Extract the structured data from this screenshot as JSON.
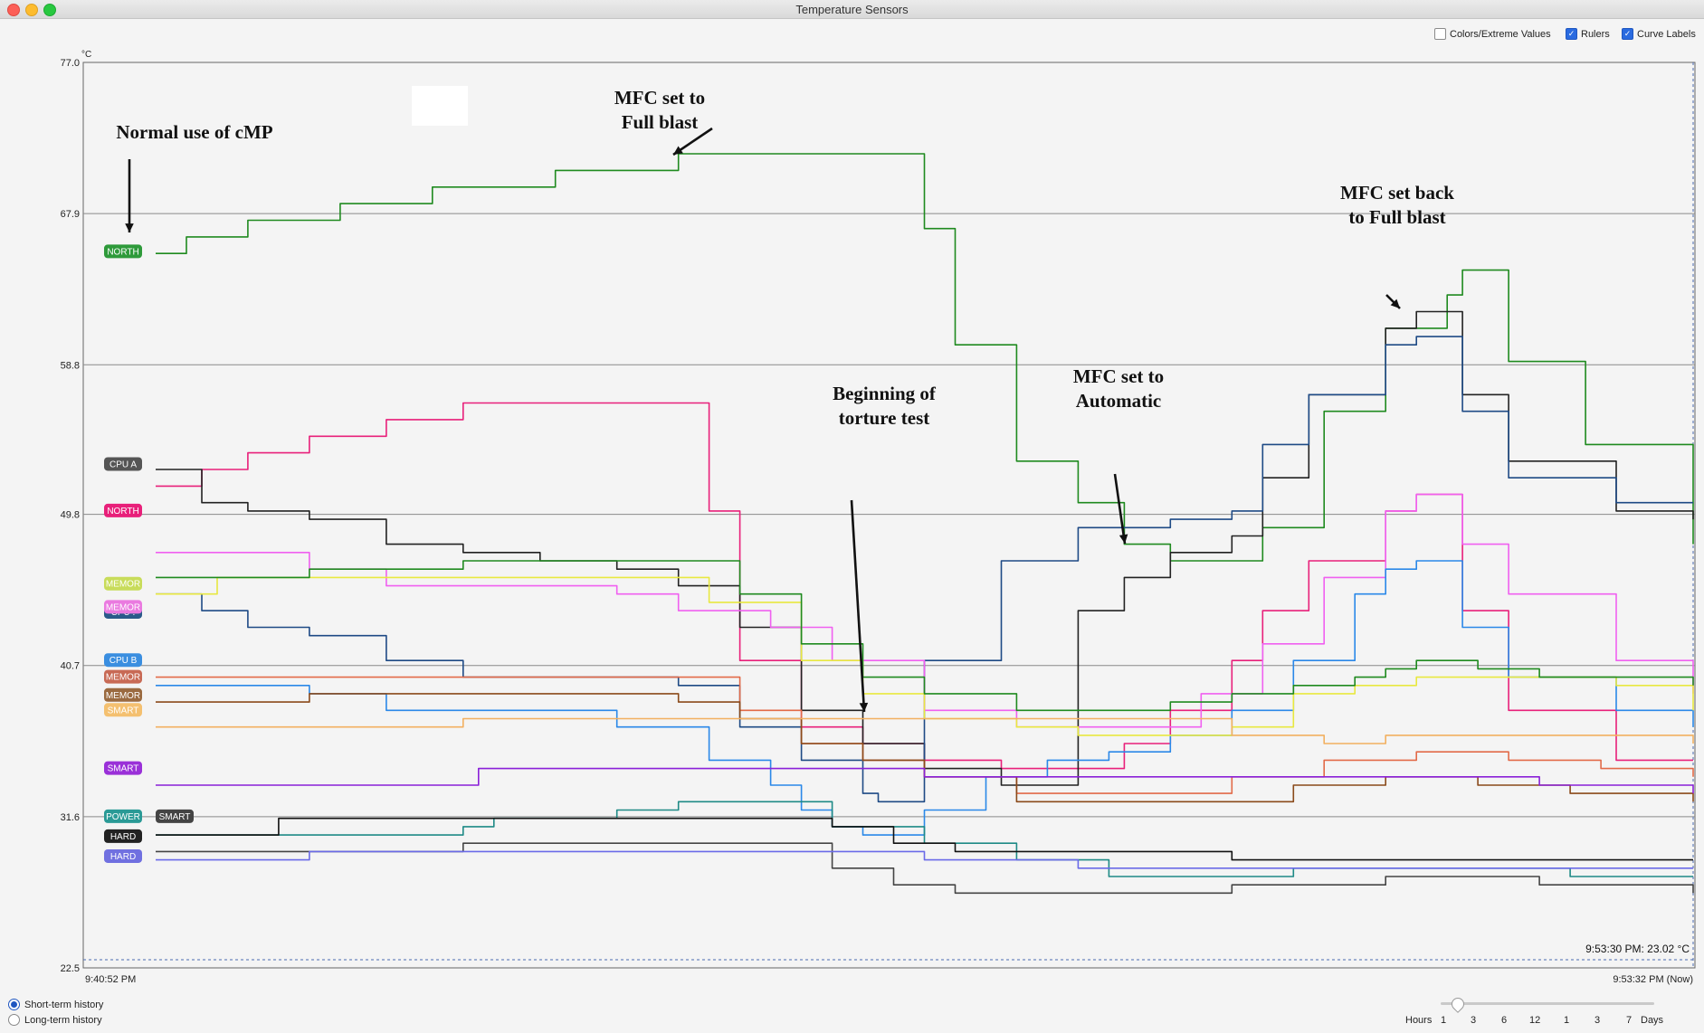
{
  "window": {
    "title": "Temperature Sensors"
  },
  "options": [
    {
      "label": "Colors/Extreme Values",
      "checked": false
    },
    {
      "label": "Rulers",
      "checked": true
    },
    {
      "label": "Curve Labels",
      "checked": true
    }
  ],
  "history": {
    "short_label": "Short-term history",
    "long_label": "Long-term history",
    "selected": "short"
  },
  "timescale": {
    "hours_label": "Hours",
    "days_label": "Days",
    "ticks": [
      "1",
      "3",
      "6",
      "12",
      "1",
      "3",
      "7"
    ]
  },
  "chart_data": {
    "type": "line",
    "unit": "°C",
    "ylim": [
      22.5,
      77.0
    ],
    "yticks": [
      "77.0",
      "67.9",
      "58.8",
      "49.8",
      "40.7",
      "31.6",
      "22.5"
    ],
    "x_start": "9:40:52 PM",
    "x_end": "9:53:32 PM (Now)",
    "readout": "9:53:30 PM: 23.02 °C",
    "grid": true,
    "curve_labels": [
      {
        "text": "NORTH",
        "color": "#2e9a3a"
      },
      {
        "text": "CPU A",
        "color": "#555555"
      },
      {
        "text": "NORTH",
        "color": "#e8207a"
      },
      {
        "text": "MEMOR",
        "color": "#c8dc5a"
      },
      {
        "text": "CPU .",
        "color": "#2a5a8a"
      },
      {
        "text": "MEMOR",
        "color": "#ea7ae0"
      },
      {
        "text": "CPU B",
        "color": "#3a8ee0"
      },
      {
        "text": "MEMOR",
        "color": "#c86a55"
      },
      {
        "text": "MEMOR",
        "color": "#9a6a40"
      },
      {
        "text": "SMART",
        "color": "#f4c070"
      },
      {
        "text": "SMART",
        "color": "#9a30d8"
      },
      {
        "text": "POWER",
        "color": "#2a9a96"
      },
      {
        "text": "SMART",
        "color": "#444444"
      },
      {
        "text": "HARD",
        "color": "#222222"
      },
      {
        "text": "HARD",
        "color": "#7070e0"
      }
    ],
    "annotations": [
      {
        "lines": [
          "Normal use of cMP"
        ]
      },
      {
        "lines": [
          "MFC set to",
          "Full blast"
        ]
      },
      {
        "lines": [
          "Beginning of",
          "torture test"
        ]
      },
      {
        "lines": [
          "MFC set to",
          "Automatic"
        ]
      },
      {
        "lines": [
          "MFC  set back",
          "to Full blast"
        ]
      }
    ],
    "series": [
      {
        "color": "#1f8a1f",
        "t": [
          0,
          0.02,
          0.06,
          0.12,
          0.18,
          0.26,
          0.34,
          0.4,
          0.44,
          0.46,
          0.5,
          0.52,
          0.56,
          0.6,
          0.63,
          0.66,
          0.69,
          0.72,
          0.76,
          0.8,
          0.84,
          0.85,
          0.88,
          0.93,
          1
        ],
        "y": [
          65.5,
          66.5,
          67.5,
          68.5,
          69.5,
          70.5,
          71.5,
          71.5,
          71.5,
          71.5,
          67,
          60,
          53,
          50.5,
          48,
          47,
          47,
          49,
          56,
          61,
          63,
          64.5,
          59,
          54,
          48
        ]
      },
      {
        "color": "#e8207a",
        "t": [
          0,
          0.03,
          0.06,
          0.1,
          0.15,
          0.2,
          0.3,
          0.34,
          0.36,
          0.38,
          0.42,
          0.46,
          0.5,
          0.55,
          0.6,
          0.63,
          0.66,
          0.7,
          0.72,
          0.75,
          0.8,
          0.82,
          0.85,
          0.88,
          0.95,
          1
        ],
        "y": [
          51.5,
          52.5,
          53.5,
          54.5,
          55.5,
          56.5,
          56.5,
          56.5,
          50,
          41,
          37,
          36,
          35,
          34.5,
          34.5,
          36,
          38,
          41,
          44,
          47,
          50,
          51,
          44,
          38,
          35,
          35
        ]
      },
      {
        "color": "#222222",
        "t": [
          0,
          0.03,
          0.06,
          0.1,
          0.15,
          0.2,
          0.25,
          0.3,
          0.34,
          0.38,
          0.42,
          0.46,
          0.5,
          0.55,
          0.6,
          0.63,
          0.66,
          0.7,
          0.72,
          0.75,
          0.8,
          0.82,
          0.85,
          0.88,
          0.95,
          1
        ],
        "y": [
          52.5,
          50.5,
          50,
          49.5,
          48,
          47.5,
          47,
          46.5,
          45.5,
          43,
          38,
          36,
          34.5,
          33.5,
          44,
          46,
          47.5,
          48.5,
          52,
          57,
          61,
          62,
          57,
          53,
          50,
          49.5
        ]
      },
      {
        "color": "#1e4a85",
        "t": [
          0,
          0.03,
          0.06,
          0.1,
          0.15,
          0.2,
          0.25,
          0.3,
          0.34,
          0.38,
          0.42,
          0.46,
          0.47,
          0.5,
          0.55,
          0.6,
          0.63,
          0.66,
          0.7,
          0.72,
          0.75,
          0.8,
          0.82,
          0.85,
          0.88,
          0.95,
          1
        ],
        "y": [
          45,
          44,
          43,
          42.5,
          41,
          40,
          40,
          40,
          39.5,
          37,
          35,
          33,
          32.5,
          41,
          47,
          49,
          49,
          49.5,
          50,
          54,
          57,
          60,
          60.5,
          56,
          52,
          50.5,
          50.5
        ]
      },
      {
        "color": "#f060f0",
        "t": [
          0,
          0.06,
          0.1,
          0.15,
          0.3,
          0.34,
          0.4,
          0.44,
          0.5,
          0.56,
          0.6,
          0.64,
          0.68,
          0.72,
          0.76,
          0.8,
          0.82,
          0.85,
          0.88,
          0.95,
          1
        ],
        "y": [
          47.5,
          47.5,
          46.5,
          45.5,
          45,
          44,
          43,
          41,
          38,
          37,
          37,
          37,
          39,
          42,
          46,
          50,
          51,
          48,
          45,
          41,
          39
        ]
      },
      {
        "color": "#2a88e8",
        "t": [
          0,
          0.06,
          0.1,
          0.15,
          0.3,
          0.36,
          0.4,
          0.42,
          0.44,
          0.46,
          0.5,
          0.54,
          0.58,
          0.62,
          0.66,
          0.7,
          0.74,
          0.78,
          0.8,
          0.82,
          0.85,
          0.88,
          0.95,
          1
        ],
        "y": [
          39.5,
          39.5,
          39,
          38,
          37,
          35,
          33.5,
          32,
          31,
          30.5,
          32,
          34,
          35,
          35.5,
          36.5,
          38,
          41,
          45,
          46.5,
          47,
          43,
          40,
          38,
          37
        ]
      },
      {
        "color": "#e8e840",
        "t": [
          0,
          0.04,
          0.08,
          0.15,
          0.3,
          0.36,
          0.42,
          0.46,
          0.5,
          0.56,
          0.6,
          0.64,
          0.7,
          0.74,
          0.78,
          0.82,
          0.86,
          0.9,
          0.95,
          1
        ],
        "y": [
          45,
          46,
          46,
          46,
          46,
          44.5,
          41,
          39,
          37.5,
          37,
          36.5,
          36.5,
          37,
          39,
          39.5,
          40,
          40,
          40,
          39.5,
          38
        ]
      },
      {
        "color": "#1f8a1f",
        "t": [
          0,
          0.05,
          0.1,
          0.2,
          0.3,
          0.34,
          0.38,
          0.42,
          0.46,
          0.5,
          0.56,
          0.62,
          0.66,
          0.7,
          0.74,
          0.78,
          0.8,
          0.82,
          0.86,
          0.9,
          1
        ],
        "y": [
          46,
          46,
          46.5,
          47,
          47,
          47,
          45,
          42,
          40,
          39,
          38,
          38,
          38.5,
          39,
          39.5,
          40,
          40.5,
          41,
          40.5,
          40,
          39.5
        ]
      },
      {
        "color": "#e26a48",
        "t": [
          0,
          0.1,
          0.2,
          0.34,
          0.38,
          0.42,
          0.46,
          0.5,
          0.56,
          0.6,
          0.66,
          0.7,
          0.76,
          0.82,
          0.88,
          0.94,
          1
        ],
        "y": [
          40,
          40,
          40,
          40,
          38,
          36,
          35,
          34,
          33,
          33,
          33,
          34,
          35,
          35.5,
          35,
          34.5,
          34
        ]
      },
      {
        "color": "#8a4a1a",
        "t": [
          0,
          0.05,
          0.1,
          0.2,
          0.34,
          0.38,
          0.42,
          0.46,
          0.5,
          0.56,
          0.62,
          0.68,
          0.74,
          0.8,
          0.86,
          0.92,
          1
        ],
        "y": [
          38.5,
          38.5,
          39,
          39,
          38.5,
          37.5,
          36,
          35,
          34,
          32.5,
          32.5,
          32.5,
          33.5,
          34,
          33.5,
          33,
          32.5
        ]
      },
      {
        "color": "#f2b060",
        "t": [
          0,
          0.1,
          0.2,
          0.3,
          0.4,
          0.5,
          0.6,
          0.7,
          0.76,
          0.8,
          0.86,
          0.92,
          1
        ],
        "y": [
          37,
          37,
          37.5,
          37.5,
          37.5,
          37.5,
          37.5,
          36.5,
          36,
          36.5,
          36.5,
          36.5,
          36
        ]
      },
      {
        "color": "#8a20d8",
        "t": [
          0,
          0.2,
          0.21,
          0.4,
          0.5,
          0.6,
          0.7,
          0.8,
          0.9,
          1
        ],
        "y": [
          33.5,
          33.5,
          34.5,
          34.5,
          34,
          34,
          34,
          34,
          33.5,
          33
        ]
      },
      {
        "color": "#1e8a86",
        "t": [
          0,
          0.2,
          0.22,
          0.3,
          0.34,
          0.4,
          0.44,
          0.5,
          0.56,
          0.62,
          0.68,
          0.74,
          0.8,
          0.86,
          0.92,
          1
        ],
        "y": [
          30.5,
          31,
          31.5,
          32,
          32.5,
          32.5,
          31,
          30,
          29,
          28,
          28,
          28.5,
          28.5,
          28.5,
          28,
          28
        ]
      },
      {
        "color": "#111111",
        "t": [
          0,
          0.08,
          0.12,
          0.2,
          0.3,
          0.4,
          0.44,
          0.48,
          0.52,
          0.6,
          0.66,
          0.7,
          0.8,
          0.9,
          1
        ],
        "y": [
          30.5,
          31.5,
          31.5,
          31.5,
          31.5,
          31.5,
          31,
          30,
          29.5,
          29.5,
          29.5,
          29,
          29,
          29,
          29
        ]
      },
      {
        "color": "#444444",
        "t": [
          0,
          0.1,
          0.2,
          0.3,
          0.36,
          0.4,
          0.44,
          0.48,
          0.52,
          0.6,
          0.66,
          0.7,
          0.8,
          0.9,
          1
        ],
        "y": [
          29.5,
          29.5,
          30,
          30,
          30,
          30,
          28.5,
          27.5,
          27,
          27,
          27,
          27.5,
          28,
          27.5,
          27
        ]
      },
      {
        "color": "#6a6ae8",
        "t": [
          0,
          0.1,
          0.2,
          0.3,
          0.4,
          0.5,
          0.6,
          0.7,
          0.8,
          0.9,
          1
        ],
        "y": [
          29,
          29.5,
          29.5,
          29.5,
          29.5,
          29,
          28.5,
          28.5,
          28.5,
          28.5,
          28.5
        ]
      }
    ]
  }
}
